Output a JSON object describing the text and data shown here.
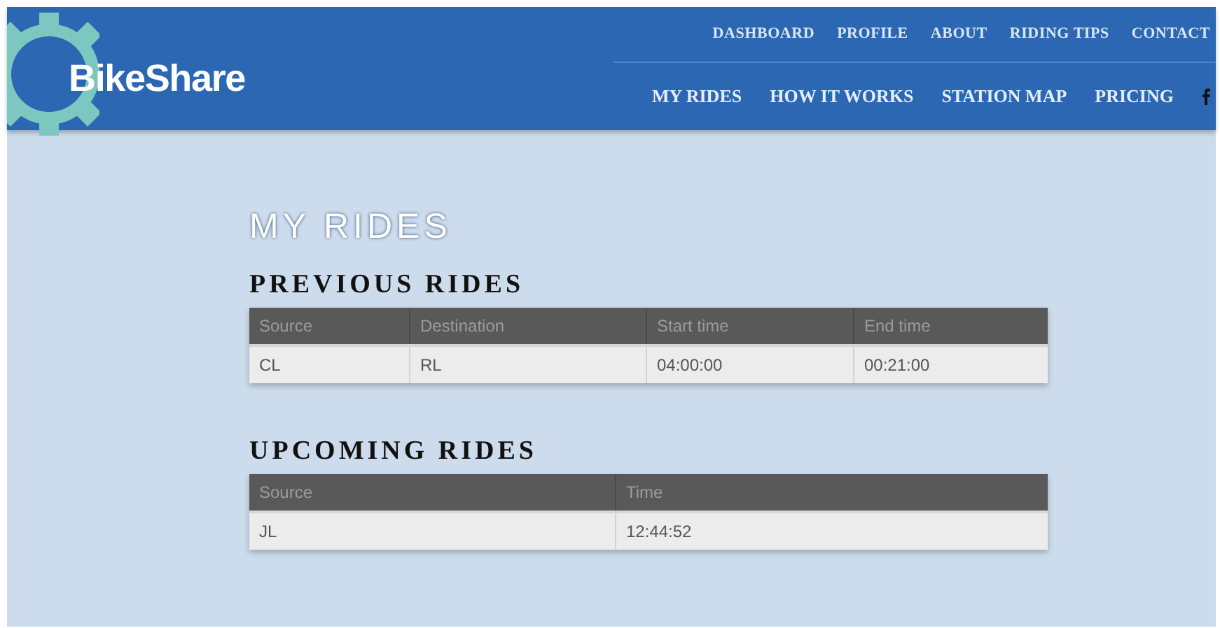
{
  "logo": {
    "text": "BikeShare"
  },
  "top_nav": [
    "DASHBOARD",
    "PROFILE",
    "ABOUT",
    "RIDING TIPS",
    "CONTACT"
  ],
  "main_nav": [
    "MY RIDES",
    "HOW IT WORKS",
    "STATION MAP",
    "PRICING"
  ],
  "page_title": "MY RIDES",
  "sections": [
    {
      "heading": "PREVIOUS RIDES",
      "columns": [
        "Source",
        "Destination",
        "Start time",
        "End time"
      ],
      "rows": [
        [
          "CL",
          "RL",
          "04:00:00",
          "00:21:00"
        ]
      ]
    },
    {
      "heading": "UPCOMING RIDES",
      "columns": [
        "Source",
        "Time"
      ],
      "rows": [
        [
          "JL",
          "12:44:52"
        ]
      ]
    }
  ]
}
